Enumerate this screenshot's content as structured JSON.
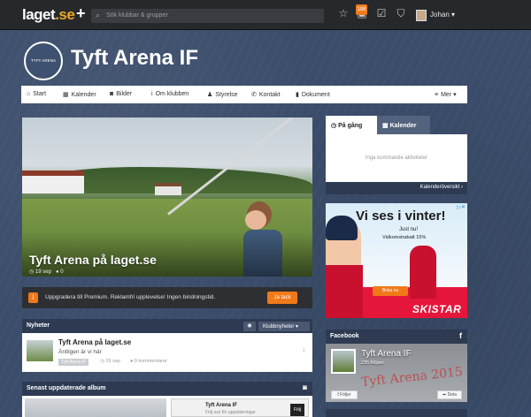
{
  "topbar": {
    "logo_text": "laget",
    "logo_suffix": ".se",
    "search_placeholder": "Sök klubbar & grupper",
    "notification_count": "188",
    "user_name": "Johan",
    "icons": [
      "plus-icon",
      "search-icon",
      "star-icon",
      "notification-icon",
      "checkbox-icon",
      "shield-icon",
      "avatar"
    ]
  },
  "club": {
    "logo_text": "TYFT ARENA",
    "name": "Tyft Arena IF"
  },
  "nav": {
    "items": [
      {
        "icon": "home-icon",
        "glyph": "⌂",
        "label": "Start"
      },
      {
        "icon": "calendar-icon",
        "glyph": "▦",
        "label": "Kalender"
      },
      {
        "icon": "camera-icon",
        "glyph": "◙",
        "label": "Bilder"
      },
      {
        "icon": "info-icon",
        "glyph": "i",
        "label": "Om klubben"
      },
      {
        "icon": "person-icon",
        "glyph": "♟",
        "label": "Styrelse"
      },
      {
        "icon": "phone-icon",
        "glyph": "✆",
        "label": "Kontakt"
      },
      {
        "icon": "document-icon",
        "glyph": "▮",
        "label": "Dokument"
      }
    ],
    "more_label": "Mer"
  },
  "hero": {
    "title": "Tyft Arena på laget.se",
    "date": "19 sep",
    "comments": "0"
  },
  "premium": {
    "text": "Uppgradera till Premium. Reklamfri upplevelse! Ingen bindningstid.",
    "button": "Ja tack"
  },
  "news": {
    "header": "Nyheter",
    "filter_label": "Klubbnyheter",
    "items": [
      {
        "title": "Tyft Arena på laget.se",
        "excerpt": "Äntligen är vi här",
        "tag": "Tyft Arena IF",
        "date": "19 sep",
        "comments": "0 kommentarer"
      }
    ]
  },
  "albums": {
    "header": "Senast uppdaterade album",
    "fb_card_title": "Tyft Arena IF",
    "fb_card_sub": "Följ oss för uppdateringar",
    "fb_card_button": "Följ"
  },
  "sidebar": {
    "tabs": [
      {
        "label": "På gång",
        "icon": "clock-icon",
        "active": true
      },
      {
        "label": "Kalender",
        "icon": "calendar-icon",
        "active": false
      }
    ],
    "no_events": "Inga kommande aktiviteter",
    "calendar_link": "Kalenderöversikt"
  },
  "ad": {
    "headline": "Vi ses i vinter!",
    "line1": "Just nu!",
    "line2": "Välkomstrabatt 15%",
    "button": "Boka nu",
    "brand": "SKISTAR"
  },
  "facebook": {
    "header": "Facebook",
    "page_name": "Tyft Arena IF",
    "likes": "235 följare",
    "follow": "Följer",
    "share": "Dela",
    "scribble": "Tyft Arena 2015"
  },
  "colors": {
    "accent": "#f07a1a",
    "topbar": "#26282c",
    "panel_header": "#2d3a52",
    "background": "#3b4d6b"
  }
}
